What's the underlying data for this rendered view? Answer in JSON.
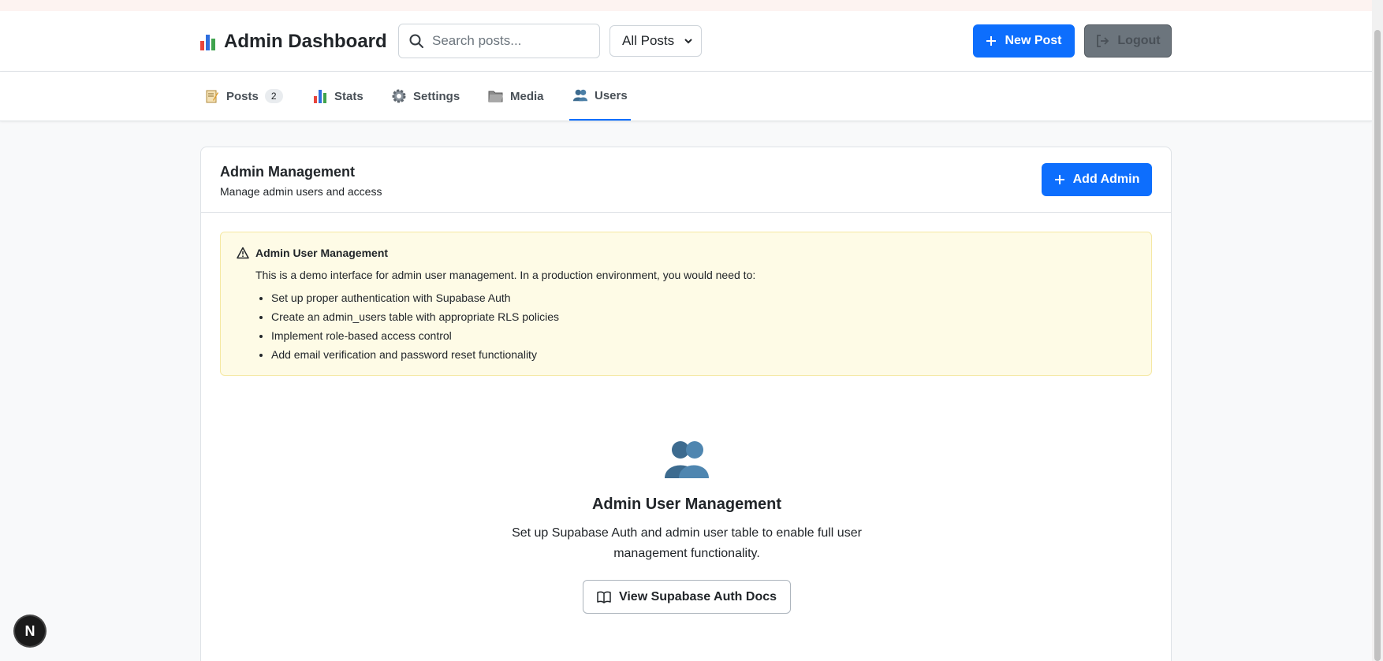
{
  "header": {
    "title": "Admin Dashboard",
    "search_placeholder": "Search posts...",
    "filter_selected": "All Posts",
    "new_post_label": "New Post",
    "logout_label": "Logout"
  },
  "tabs": [
    {
      "label": "Posts",
      "count": "2",
      "icon": "memo-icon"
    },
    {
      "label": "Stats",
      "icon": "bar-chart-icon"
    },
    {
      "label": "Settings",
      "icon": "gear-icon"
    },
    {
      "label": "Media",
      "icon": "folder-icon"
    },
    {
      "label": "Users",
      "icon": "users-icon",
      "active": true
    }
  ],
  "card": {
    "title": "Admin Management",
    "subtitle": "Manage admin users and access",
    "add_admin_label": "Add Admin"
  },
  "alert": {
    "title": "Admin User Management",
    "intro": "This is a demo interface for admin user management. In a production environment, you would need to:",
    "items": [
      "Set up proper authentication with Supabase Auth",
      "Create an admin_users table with appropriate RLS policies",
      "Implement role-based access control",
      "Add email verification and password reset functionality"
    ]
  },
  "empty_state": {
    "title": "Admin User Management",
    "description": "Set up Supabase Auth and admin user table to enable full user management functionality.",
    "docs_button_label": "View Supabase Auth Docs"
  },
  "colors": {
    "primary": "#0d6efd",
    "alert_bg": "#fefbe6",
    "secondary": "#6c757d"
  },
  "badge_letter": "N"
}
